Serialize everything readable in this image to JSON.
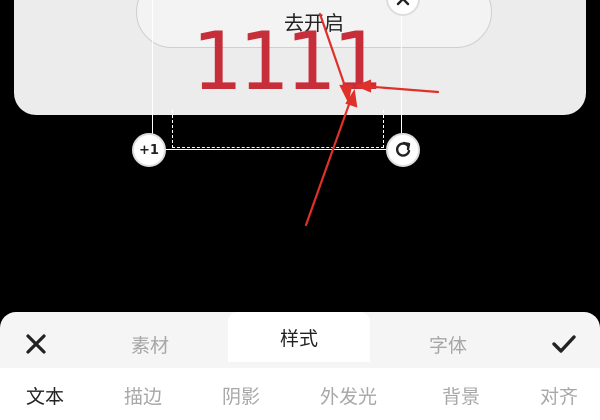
{
  "overlay": {
    "pill_label": "去开启",
    "big_text": "1111",
    "big_text_color": "#c62f3a",
    "plus_handle_label": "+1"
  },
  "icons": {
    "close": "close-icon",
    "rotate": "rotate-icon",
    "confirm": "check-icon",
    "plus": "plus-one-icon"
  },
  "panel": {
    "tabs": [
      {
        "label": "素材",
        "active": false
      },
      {
        "label": "样式",
        "active": true
      },
      {
        "label": "字体",
        "active": false
      }
    ],
    "sub_tabs": [
      {
        "label": "文本",
        "active": true
      },
      {
        "label": "描边",
        "active": false
      },
      {
        "label": "阴影",
        "active": false
      },
      {
        "label": "外发光",
        "active": false
      },
      {
        "label": "背景",
        "active": false
      },
      {
        "label": "对齐",
        "active": false
      }
    ]
  },
  "colors": {
    "annotation_arrow": "#e0302a",
    "panel_bg": "#f5f5f5",
    "inactive_text": "#a7a7a7"
  }
}
